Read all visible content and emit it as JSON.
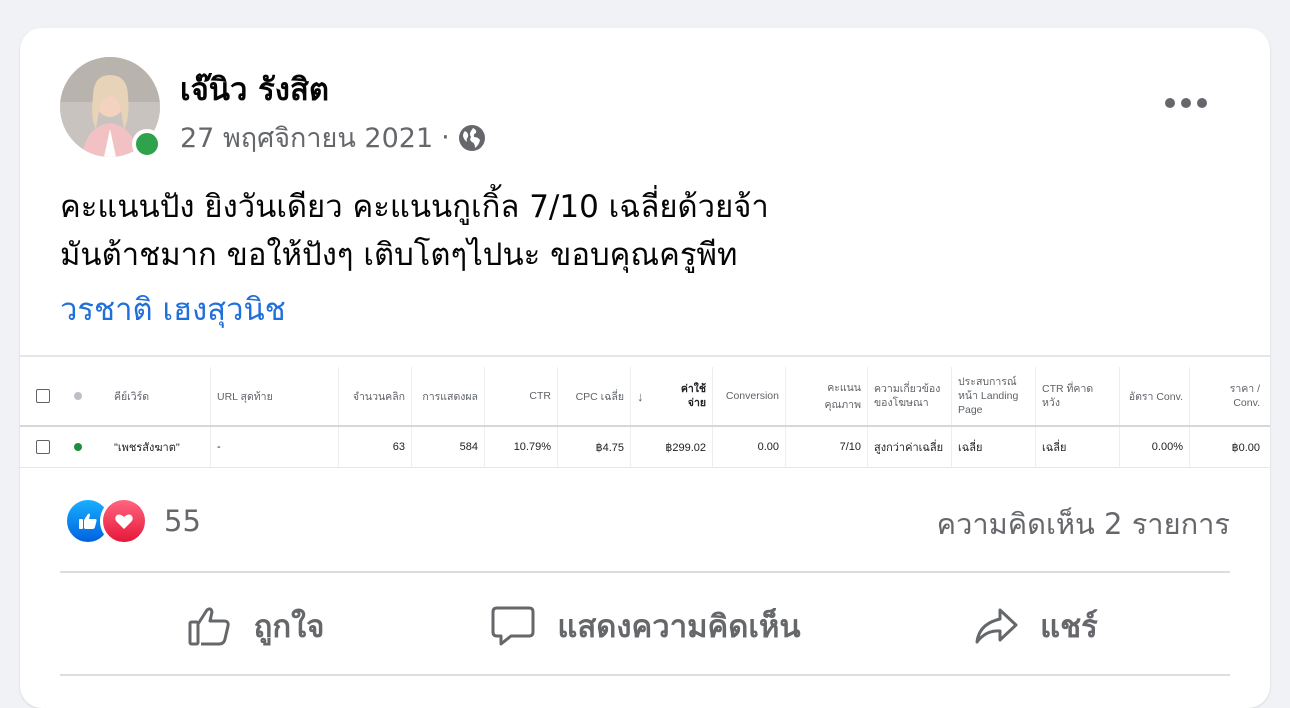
{
  "post": {
    "author": "เจ๊นิว รังสิต",
    "date": "27 พฤศจิกายน 2021",
    "separator": "·",
    "privacy_icon": "globe-icon",
    "text_line1": "คะแนนปัง ยิงวันเดียว คะแนนกูเกิ้ล 7/10 เฉลี่ยด้วยจ้า",
    "text_line2": "มันต้าชมาก ขอให้ปังๆ เติบโตๆไปนะ ขอบคุณครูพีท",
    "tagged": "วรชาติ เฮงสุวนิช"
  },
  "table": {
    "headers": {
      "keyword": "คีย์เวิร์ด",
      "final_url": "URL สุดท้าย",
      "clicks": "จำนวนคลิก",
      "impressions": "การแสดงผล",
      "ctr": "CTR",
      "avg_cpc": "CPC เฉลี่ย",
      "sort_arrow": "↓",
      "cost_l1": "ค่าใช้",
      "cost_l2": "จ่าย",
      "conversion": "Conversion",
      "quality_score": "คะแนนคุณภาพ",
      "ad_relevance_l1": "ความเกี่ยวข้อง",
      "ad_relevance_l2": "ของโฆษณา",
      "landing_l1": "ประสบการณ์",
      "landing_l2": "หน้า Landing",
      "landing_l3": "Page",
      "exp_ctr_l1": "CTR ที่คาด",
      "exp_ctr_l2": "หวัง",
      "conv_rate": "อัตรา Conv.",
      "cost_conv_l1": "ราคา /",
      "cost_conv_l2": "Conv."
    },
    "row": {
      "keyword": "\"เพชรสังฆาต\"",
      "final_url": "-",
      "clicks": "63",
      "impressions": "584",
      "ctr": "10.79%",
      "avg_cpc": "฿4.75",
      "cost": "฿299.02",
      "conversion": "0.00",
      "quality_score": "7/10",
      "ad_relevance": "สูงกว่าค่าเฉลี่ย",
      "landing": "เฉลี่ย",
      "exp_ctr": "เฉลี่ย",
      "conv_rate": "0.00%",
      "cost_conv": "฿0.00"
    },
    "status_color": "#1e8e3e"
  },
  "engagement": {
    "reaction_count": "55",
    "comments": "ความคิดเห็น 2 รายการ"
  },
  "actions": {
    "like": "ถูกใจ",
    "comment": "แสดงความคิดเห็น",
    "share": "แชร์"
  }
}
